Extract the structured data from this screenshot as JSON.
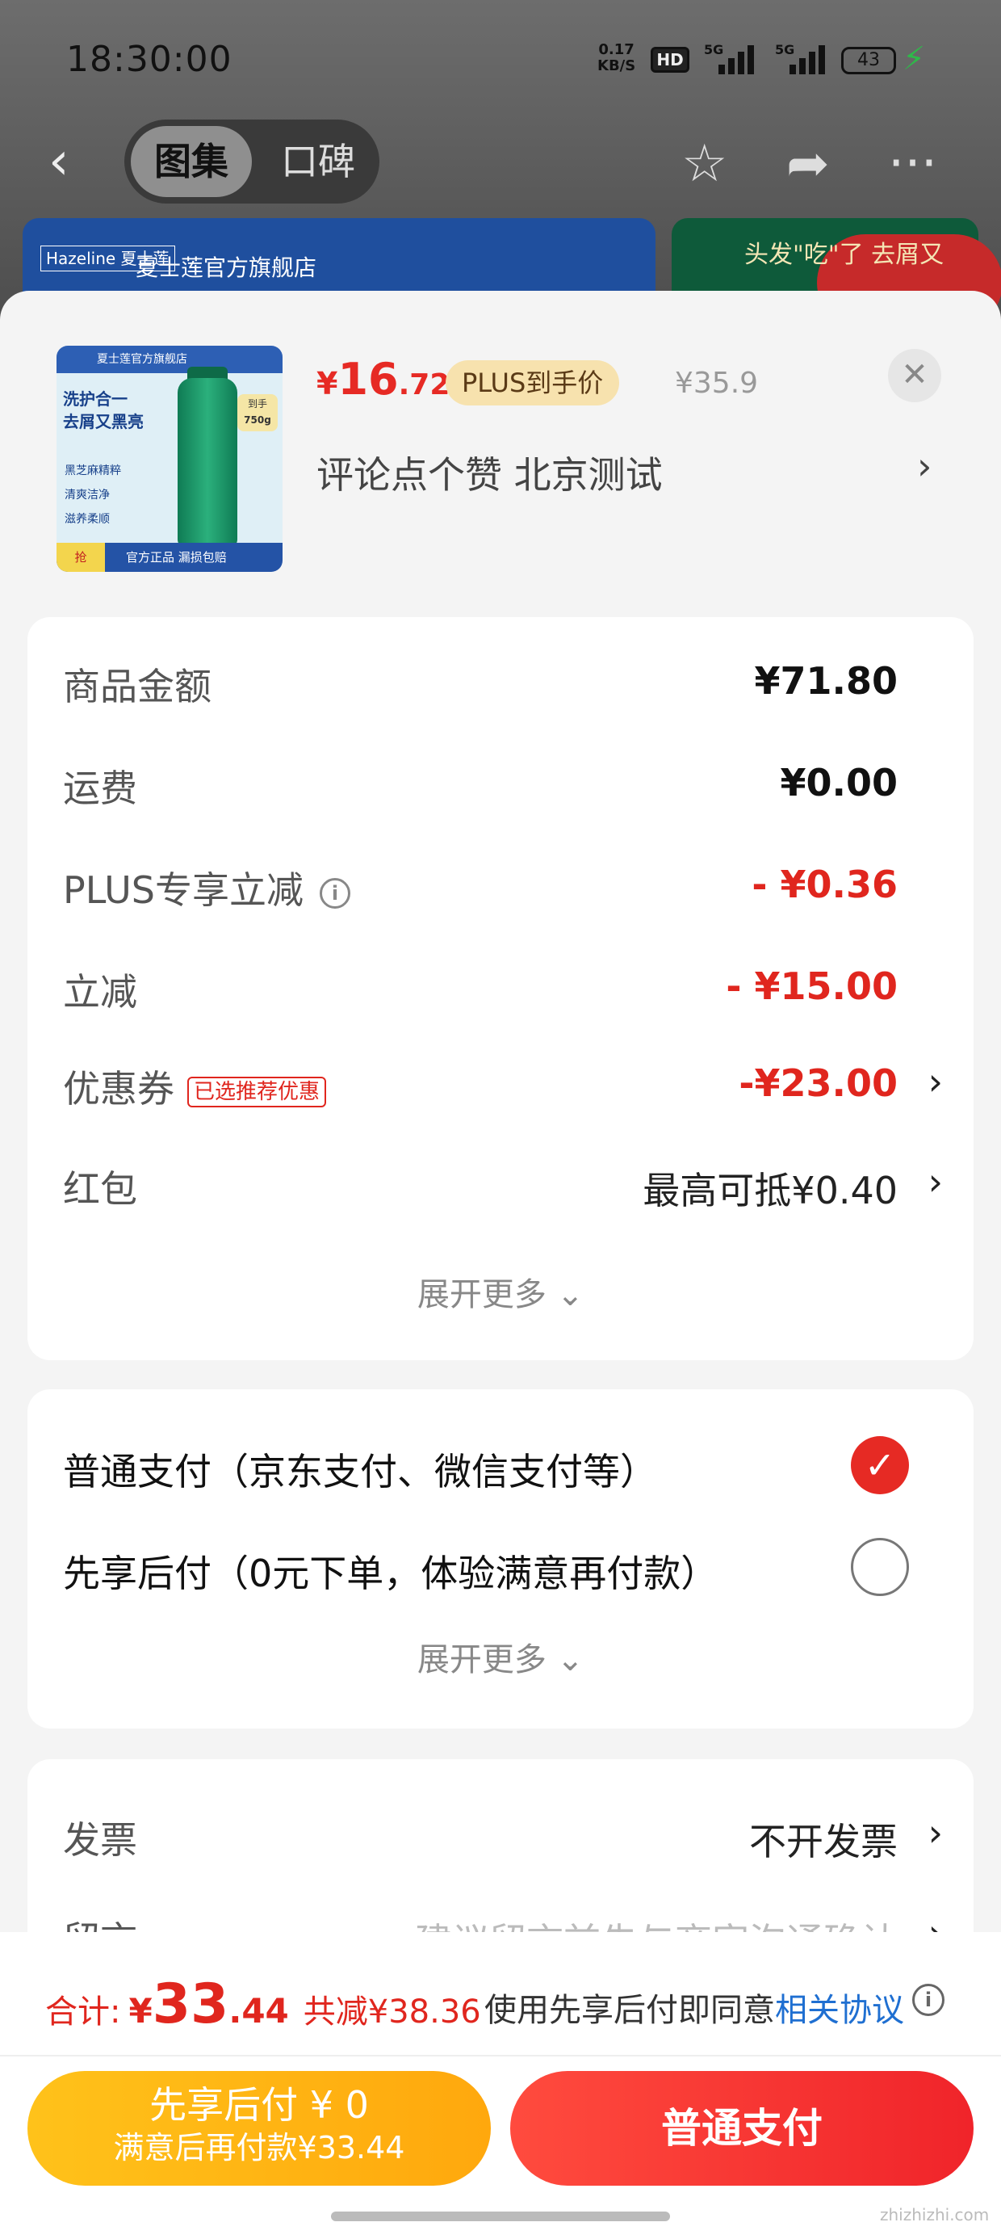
{
  "status": {
    "time": "18:30:00",
    "speed_value": "0.17",
    "speed_unit": "KB/S",
    "hd": "HD",
    "net1": "5G",
    "net2": "5G",
    "battery": "43"
  },
  "nav": {
    "tab_active": "图集",
    "tab_inactive": "口碑"
  },
  "bg_banners": {
    "left_title": "夏士莲官方旗舰店",
    "left_logo": "Hazeline 夏士莲",
    "right_title": "头发\"吃\"了 去屑又"
  },
  "product": {
    "thumb": {
      "store": "夏士莲官方旗舰店",
      "headline1": "洗护合一",
      "headline2": "去屑又黑亮",
      "tag1": "到手",
      "tag2": "750g",
      "features": [
        "黑芝麻精粹",
        "清爽洁净",
        "滋养柔顺"
      ],
      "footer_badge": "抢",
      "footer": "官方正品 漏损包赔"
    },
    "price_symbol": "¥",
    "price_int": "16",
    "price_dec": ".72",
    "plus_tag": "PLUS到手价",
    "original_price": "¥35.9",
    "sku": "评论点个赞  北京测试"
  },
  "summary": {
    "rows": [
      {
        "label": "商品金额",
        "value": "¥71.80"
      },
      {
        "label": "运费",
        "value": "¥0.00"
      },
      {
        "label": "PLUS专享立减",
        "value": "- ¥0.36"
      },
      {
        "label": "立减",
        "value": "- ¥15.00"
      },
      {
        "label": "优惠券",
        "tag": "已选推荐优惠",
        "value": "-¥23.00"
      },
      {
        "label": "红包",
        "value": "最高可抵¥0.40"
      }
    ],
    "expand": "展开更多"
  },
  "payment": {
    "options": [
      {
        "label": "普通支付（京东支付、微信支付等）",
        "selected": true
      },
      {
        "label": "先享后付（0元下单，体验满意再付款）",
        "selected": false
      }
    ],
    "expand": "展开更多"
  },
  "extras": {
    "invoice_label": "发票",
    "invoice_value": "不开发票",
    "note_label": "留言",
    "note_placeholder": "建议留言前先与商家沟通确认"
  },
  "bottom": {
    "total_label": "合计:",
    "total_symbol": "¥",
    "total_int": "33",
    "total_dec": ".44",
    "total_saved": "共减¥38.36",
    "agree_text": "使用先享后付即同意",
    "agree_link": "相关协议",
    "btn_later_line1": "先享后付 ¥ 0",
    "btn_later_line2": "满意后再付款¥33.44",
    "btn_pay": "普通支付"
  },
  "watermark": "zhizhizhi.com",
  "colors": {
    "accent_red": "#e62a24",
    "link_blue": "#1f6fd1",
    "later_yellow": "#ffb215"
  }
}
